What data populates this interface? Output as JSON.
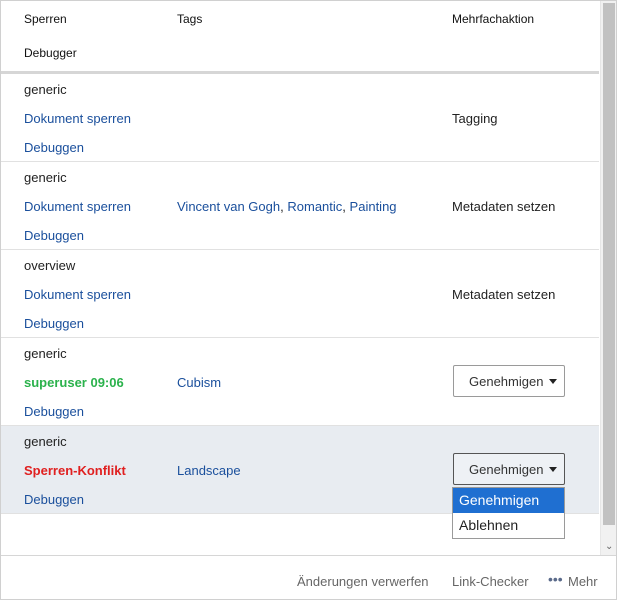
{
  "header": {
    "col_lock": "Sperren",
    "col_tags": "Tags",
    "col_multi": "Mehrfachaktion",
    "col_debugger": "Debugger"
  },
  "rows": [
    {
      "type": "generic",
      "lock": "Dokument sperren",
      "tags": [],
      "action": "Tagging",
      "debug": "Debuggen"
    },
    {
      "type": "generic",
      "lock": "Dokument sperren",
      "tags": [
        "Vincent van Gogh",
        "Romantic",
        "Painting"
      ],
      "action": "Metadaten setzen",
      "debug": "Debuggen"
    },
    {
      "type": "overview",
      "lock": "Dokument sperren",
      "tags": [],
      "action": "Metadaten setzen",
      "debug": "Debuggen"
    },
    {
      "type": "generic",
      "lock": "superuser 09:06",
      "tags": [
        "Cubism"
      ],
      "action": "Genehmigen",
      "debug": "Debuggen"
    },
    {
      "type": "generic",
      "lock": "Sperren-Konflikt",
      "tags": [
        "Landscape"
      ],
      "action": "Genehmigen",
      "debug": "Debuggen"
    }
  ],
  "dropdown": {
    "options": [
      "Genehmigen",
      "Ablehnen"
    ],
    "highlighted": "Genehmigen"
  },
  "tag_separator": ",",
  "footer": {
    "discard": "Änderungen verwerfen",
    "link_checker": "Link-Checker",
    "more_dots": "•••",
    "more": "Mehr"
  },
  "colors": {
    "link": "#1a4f9c",
    "lock_owner": "#2bb24c",
    "lock_conflict": "#e02020",
    "selected_row": "#e8ecf1",
    "dropdown_highlight": "#1f6fd1"
  }
}
